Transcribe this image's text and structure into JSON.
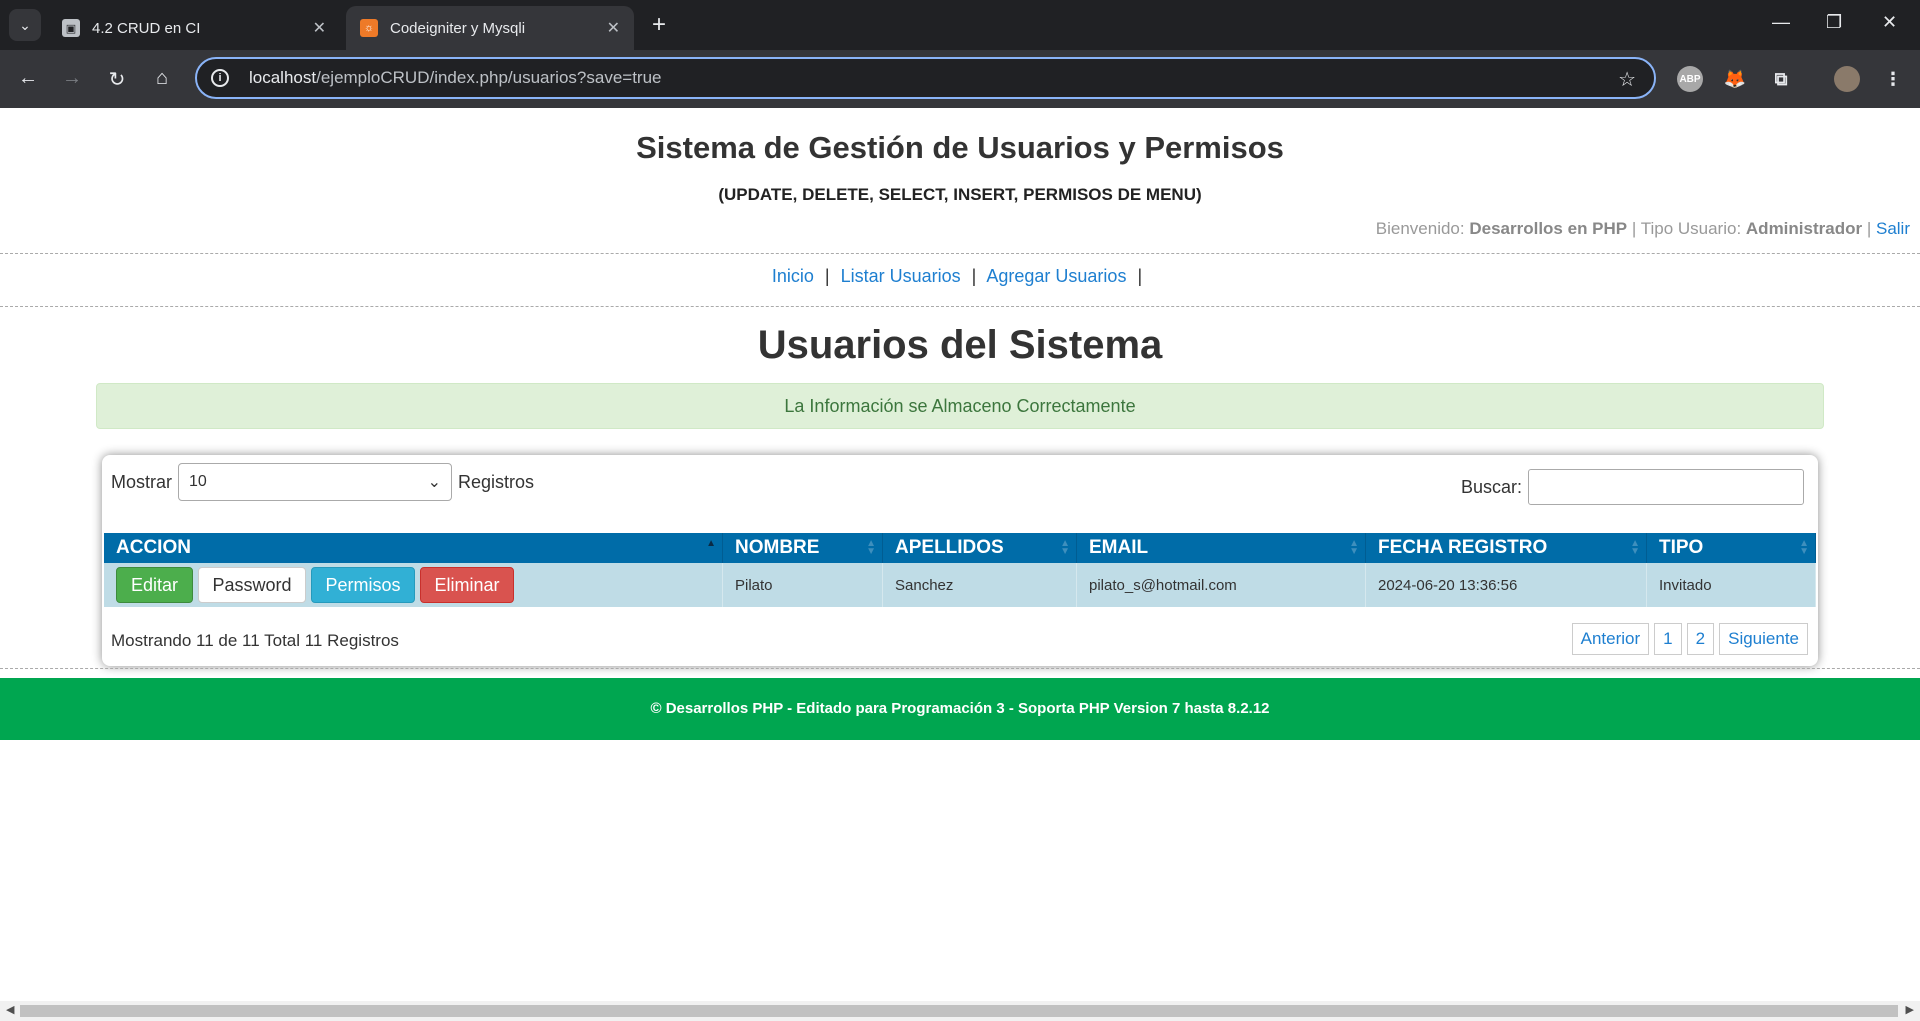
{
  "browser": {
    "tabs": [
      {
        "title": "4.2 CRUD en CI",
        "icon": "user-account-icon"
      },
      {
        "title": "Codeigniter y Mysqli",
        "icon": "codeigniter-icon"
      }
    ],
    "url_host": "localhost",
    "url_path": "/ejemploCRUD/index.php/usuarios?save=true",
    "extensions": [
      "ABP"
    ]
  },
  "header": {
    "title": "Sistema de Gestión de Usuarios y Permisos",
    "subtitle": "(UPDATE, DELETE, SELECT, INSERT, PERMISOS DE MENU)",
    "welcome_label": "Bienvenido:",
    "user_name": "Desarrollos en PHP",
    "sep": "|",
    "type_label": "Tipo Usuario:",
    "user_type": "Administrador",
    "logout": "Salir"
  },
  "menu": {
    "items": [
      "Inicio",
      "Listar Usuarios",
      "Agregar Usuarios"
    ],
    "sep": "|"
  },
  "main": {
    "heading": "Usuarios del Sistema",
    "alert": "La Información se Almaceno Correctamente"
  },
  "table": {
    "show_label": "Mostrar",
    "page_size": "10",
    "records_label": "Registros",
    "search_label": "Buscar:",
    "columns": [
      "ACCION",
      "NOMBRE",
      "APELLIDOS",
      "EMAIL",
      "FECHA REGISTRO",
      "TIPO"
    ],
    "actions": {
      "edit": "Editar",
      "password": "Password",
      "permissions": "Permisos",
      "delete": "Eliminar"
    },
    "rows": [
      {
        "nombre": "Pilato",
        "apellidos": "Sanchez",
        "email": "pilato_s@hotmail.com",
        "fecha": "2024-06-20 13:36:56",
        "tipo": "Invitado"
      }
    ],
    "summary": "Mostrando 11 de 11 Total 11 Registros",
    "pagination": {
      "prev": "Anterior",
      "pages": [
        "1",
        "2"
      ],
      "next": "Siguiente"
    }
  },
  "footer": {
    "text": "© Desarrollos PHP - Editado para Programación 3 - Soporta PHP Version 7 hasta 8.2.12"
  },
  "colors": {
    "table_header": "#006ca8",
    "row_bg": "#bfdce6",
    "footer_bg": "#00a650",
    "alert_bg": "#dff0d8",
    "link": "#1e7fd0"
  }
}
